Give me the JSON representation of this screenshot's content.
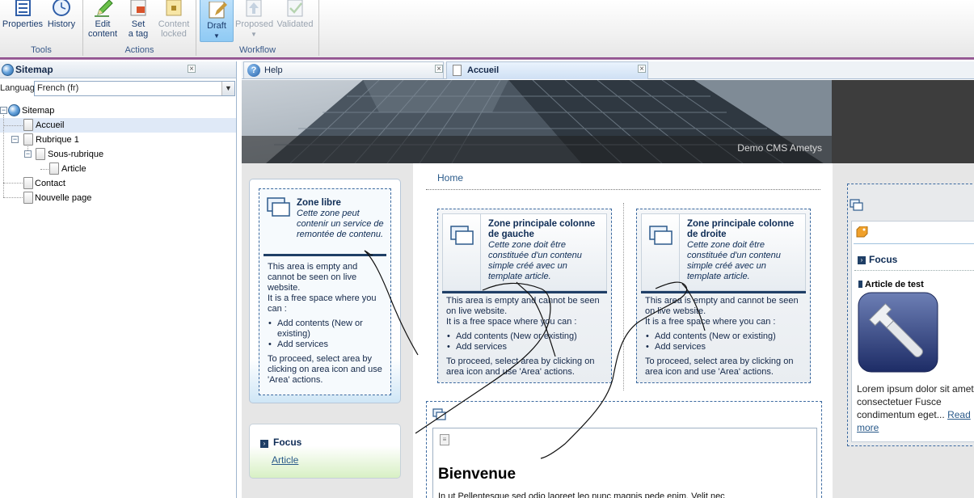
{
  "ribbon": {
    "groups": [
      {
        "title": "Tools",
        "buttons": [
          {
            "label": "Properties"
          },
          {
            "label": "History"
          }
        ]
      },
      {
        "title": "Actions",
        "buttons": [
          {
            "label": "Edit content"
          },
          {
            "label": "Set a tag"
          },
          {
            "label": "Content locked"
          }
        ]
      },
      {
        "title": "Workflow",
        "buttons": [
          {
            "label": "Draft"
          },
          {
            "label": "Proposed"
          },
          {
            "label": "Validated"
          }
        ]
      }
    ],
    "btn": {
      "properties_1": "Properties",
      "history_1": "History",
      "edit_1": "Edit",
      "edit_2": "content",
      "tag_1": "Set",
      "tag_2": "a tag",
      "locked_1": "Content",
      "locked_2": "locked",
      "draft_1": "Draft",
      "proposed_1": "Proposed",
      "validated_1": "Validated"
    },
    "accent": "#7a2b78"
  },
  "sitemap": {
    "title": "Sitemap",
    "language_label": "Language",
    "language_value": "French (fr)",
    "tree": {
      "root": "Sitemap",
      "accueil": "Accueil",
      "rubrique1": "Rubrique 1",
      "sous_rubrique": "Sous-rubrique",
      "article": "Article",
      "contact": "Contact",
      "nouvelle_page": "Nouvelle page"
    }
  },
  "tabs": {
    "help": "Help",
    "accueil": "Accueil"
  },
  "page": {
    "banner_caption": "Demo CMS Ametys",
    "breadcrumb": "Home",
    "zone_libre": {
      "title": "Zone libre",
      "desc": "Cette zone peut contenir un service de remontée de contenu.",
      "p1": "This area is empty and cannot be seen on live website.",
      "p2": "It is a free space where you can :",
      "li1": "Add contents (New or existing)",
      "li2": "Add services",
      "p3": "To proceed, select area by clicking on area icon and use 'Area' actions."
    },
    "focus_left": {
      "title": "Focus",
      "link": "Article"
    },
    "zone_gauche": {
      "title": "Zone principale colonne de gauche",
      "desc": "Cette zone doit être constituée d'un contenu simple créé avec un template article.",
      "p1": "This area is empty and cannot be seen on live website.",
      "p2": "It is a free space where you can :",
      "li1": "Add contents (New or existing)",
      "li2": "Add services",
      "p3": "To proceed, select area by clicking on area icon and use 'Area' actions."
    },
    "zone_droite": {
      "title": "Zone principale colonne de droite",
      "desc": "Cette zone doit être constituée d'un contenu simple créé avec un template article.",
      "p1": "This area is empty and cannot be seen on live website.",
      "p2": "It is a free space where you can :",
      "li1": "Add contents (New or existing)",
      "li2": "Add services",
      "p3": "To proceed, select area by clicking on area icon and use 'Area' actions."
    },
    "bienvenue": {
      "title": "Bienvenue",
      "text": "In ut Pellentesque sed odio laoreet leo nunc magnis pede enim. Velit nec"
    },
    "focus_right": {
      "title": "Focus",
      "article_title": "Article de test",
      "text": "Lorem ipsum dolor sit amet consectetuer Fusce condimentum eget...",
      "read": "Read",
      "more": "more"
    }
  }
}
